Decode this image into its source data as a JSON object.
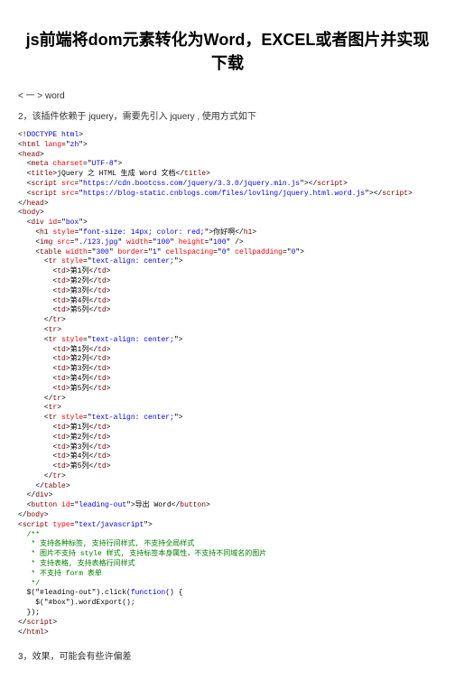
{
  "title": "js前端将dom元素转化为Word，EXCEL或者图片并实现下载",
  "section1_header": "< 一 >   word",
  "desc1": "2，该插件依赖于 jquery，需要先引入 jquery , 使用方式如下",
  "code": {
    "l01a": "<!",
    "l01b": "DOCTYPE html",
    "l01c": ">",
    "l02a": "<",
    "l02b": "html ",
    "l02c": "lang",
    "l02d": "=\"",
    "l02e": "zh",
    "l02f": "\">",
    "l03a": "<",
    "l03b": "head",
    "l03c": ">",
    "l04a": "  <",
    "l04b": "meta ",
    "l04c": "charset",
    "l04d": "=\"",
    "l04e": "UTF-8",
    "l04f": "\">",
    "l05a": "  <",
    "l05b": "title",
    "l05c": ">",
    "l05d": "jQuery 之 HTML 生成 Word 文档",
    "l05e": "</",
    "l05f": "title",
    "l05g": ">",
    "l06a": "  <",
    "l06b": "script ",
    "l06c": "src",
    "l06d": "=\"",
    "l06e": "https://cdn.bootcss.com/jquery/3.3.0/jquery.min.js",
    "l06f": "\"></",
    "l06g": "script",
    "l06h": ">",
    "l07a": "  <",
    "l07b": "script ",
    "l07c": "src",
    "l07d": "=\"",
    "l07e": "https://blog-static.cnblogs.com/files/lovling/jquery.html.word.js",
    "l07f": "\"></",
    "l07g": "script",
    "l07h": ">",
    "l08a": "</",
    "l08b": "head",
    "l08c": ">",
    "l09a": "<",
    "l09b": "body",
    "l09c": ">",
    "l10a": "  <",
    "l10b": "div ",
    "l10c": "id",
    "l10d": "=\"",
    "l10e": "box",
    "l10f": "\">",
    "l11a": "    <",
    "l11b": "h1 ",
    "l11c": "style",
    "l11d": "=\"",
    "l11e": "font-size: 14px; color: red;",
    "l11f": "\">",
    "l11g": "你好啊",
    "l11h": "</",
    "l11i": "h1",
    "l11j": ">",
    "l12a": "    <",
    "l12b": "img ",
    "l12c": "src",
    "l12d": "=\"",
    "l12e": "./123.jpg",
    "l12f": "\" ",
    "l12g": "width",
    "l12h": "=\"",
    "l12i": "100",
    "l12j": "\" ",
    "l12k": "height",
    "l12l": "=\"",
    "l12m": "100",
    "l12n": "\" />",
    "l13a": "    <",
    "l13b": "table ",
    "l13c": "width",
    "l13d": "=\"",
    "l13e": "300",
    "l13f": "\" ",
    "l13g": "border",
    "l13h": "=\"",
    "l13i": "1",
    "l13j": "\" ",
    "l13k": "cellspacing",
    "l13l": "=\"",
    "l13m": "0",
    "l13n": "\" ",
    "l13o": "cellpadding",
    "l13p": "=\"",
    "l13q": "0",
    "l13r": "\">",
    "l14a": "      <",
    "l14b": "tr ",
    "l14c": "style",
    "l14d": "=\"",
    "l14e": "text-align: center;",
    "l14f": "\">",
    "cell_open": "        <",
    "cell_tag": "td",
    "cell_gt": ">",
    "cell_close1": "</",
    "cell_close2": ">",
    "c1": "第1列",
    "c2": "第2列",
    "c3": "第3列",
    "c4": "第4列",
    "c5": "第5列",
    "tr_close_a": "      </",
    "tr_close_b": "tr",
    "tr_close_c": ">",
    "tr_open_a": "      <",
    "tr_open_b": "tr",
    "tr_open_c": ">",
    "tbl_close_a": "    </",
    "tbl_close_b": "table",
    "tbl_close_c": ">",
    "div_close_a": "  </",
    "div_close_b": "div",
    "div_close_c": ">",
    "btn_a": "  <",
    "btn_b": "button ",
    "btn_c": "id",
    "btn_d": "=\"",
    "btn_e": "leading-out",
    "btn_f": "\">",
    "btn_g": "导出 Word",
    "btn_h": "</",
    "btn_i": "button",
    "btn_j": ">",
    "body_close_a": "</",
    "body_close_b": "body",
    "body_close_c": ">",
    "scr_a": "<",
    "scr_b": "script ",
    "scr_c": "type",
    "scr_d": "=\"",
    "scr_e": "text/javascript",
    "scr_f": "\">",
    "cm1": "  /**",
    "cm2": "   * 支持各种标签, 支持行间样式, 不支持全局样式",
    "cm3": "   * 图片不支持 style 样式, 支持标签本身属性，不支持不同域名的图片",
    "cm4": "   * 支持表格, 支持表格行间样式",
    "cm5": "   * 不支持 form 表单",
    "cm6": "   */",
    "js1a": "  $(\"#leading-out\").click(",
    "js1b": "function",
    "js1c": "() {",
    "js2": "    $(\"#box\").wordExport();",
    "js3": "  });",
    "scr_close_a": "</",
    "scr_close_b": "script",
    "scr_close_c": ">",
    "html_close_a": "</",
    "html_close_b": "html",
    "html_close_c": ">"
  },
  "desc2": "3，效果，可能会有些许偏差"
}
